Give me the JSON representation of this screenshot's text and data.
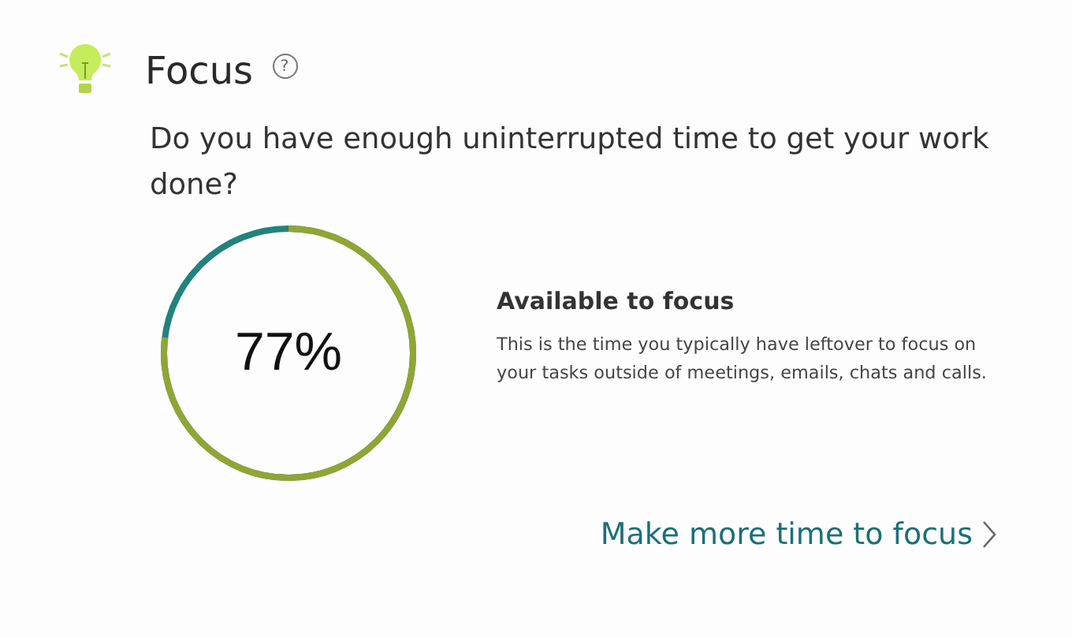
{
  "header": {
    "title": "Focus",
    "help": "?"
  },
  "question": "Do you have enough uninterrupted time to get your work done?",
  "meter": {
    "level": 0.77,
    "reading": "77%"
  },
  "detail": {
    "heading": "Available to focus",
    "text": "This is the time you typically have leftover to focus on your tasks outside of meetings, emails, chats and calls."
  },
  "link": {
    "label": "Make more time to focus"
  }
}
